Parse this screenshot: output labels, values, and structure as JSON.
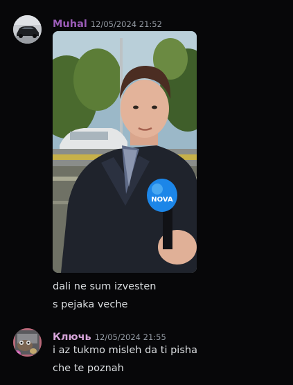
{
  "messages": [
    {
      "author": "Muhal",
      "author_color": "#9b5cb8",
      "timestamp": "12/05/2024 21:52",
      "lines": [
        "dali ne sum izvesten",
        "s pejaka veche"
      ],
      "attachment": {
        "type": "image",
        "mic_brand": "NOVA"
      }
    },
    {
      "author": "Ключь",
      "author_color": "#d6a4d9",
      "timestamp": "12/05/2024 21:55",
      "lines": [
        "i az tukmo misleh da ti pisha",
        "che te poznah"
      ]
    }
  ],
  "colors": {
    "background": "#070709",
    "text": "#dbdee1",
    "muted": "#949ba4"
  }
}
